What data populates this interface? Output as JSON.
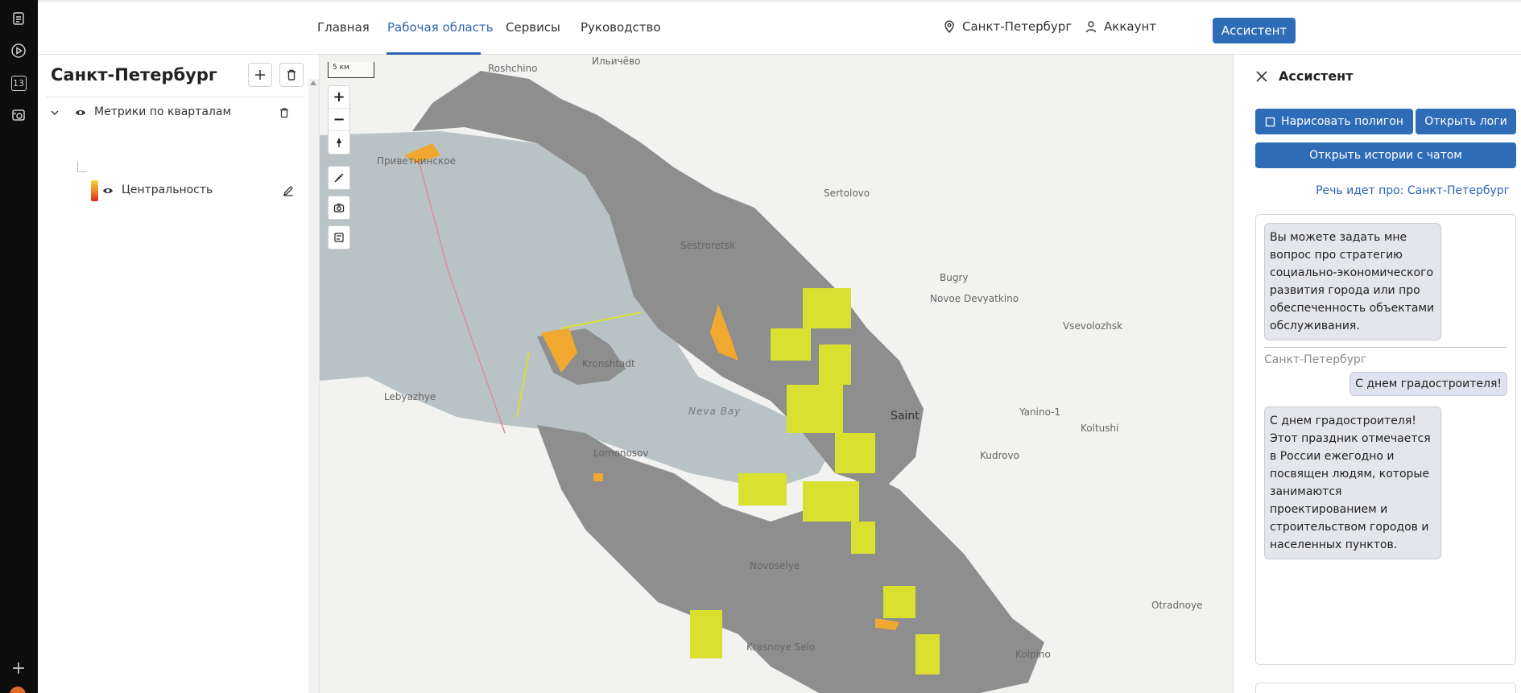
{
  "nav": {
    "tabs": [
      {
        "label": "Главная"
      },
      {
        "label": "Рабочая область"
      },
      {
        "label": "Сервисы"
      },
      {
        "label": "Руководство"
      }
    ],
    "active_tab": "Рабочая область",
    "location": "Санкт-Петербург",
    "account": "Аккаунт",
    "assistant_button": "Ассистент"
  },
  "rail": {
    "icons": [
      "document-icon",
      "play-icon",
      "calendar-13-icon",
      "camera-box-icon"
    ],
    "calendar_badge": "13"
  },
  "layers": {
    "title": "Санкт-Петербург",
    "groups": [
      {
        "name": "Метрики по кварталам",
        "children": [
          {
            "name": "Центральность"
          }
        ]
      }
    ]
  },
  "map": {
    "scale_label": "5 км",
    "labels": [
      "Roshchino",
      "Ильичёво",
      "Приветнинское",
      "Sertolovo",
      "Sestroretsk",
      "Novoe Devyatkino",
      "Vsevolozhsk",
      "Kronshtadt",
      "Lebyazhye",
      "Neva Bay",
      "Yanino-1",
      "Koltushi",
      "Novoselye",
      "Krasnoye Selo",
      "Otradnoye",
      "Kolpino",
      "Saint",
      "Bugry",
      "Kudrovo",
      "Lomonosov"
    ],
    "colors": {
      "water": "#b9c3c6",
      "land": "#8e8e8e",
      "metric_high": "#d9e02f",
      "metric_mid": "#f0a830",
      "boundary": "#e08a9a"
    }
  },
  "assistant": {
    "title": "Ассистент",
    "draw_polygon": "Нарисовать полигон",
    "open_logs": "Открыть логи",
    "open_history": "Открыть истории с чатом",
    "topic": "Речь идет про: Санкт-Петербург",
    "messages": [
      {
        "role": "assistant",
        "text": "Вы можете задать мне вопрос про стратегию социально-экономического развития города или про обеспеченность объектами обслуживания."
      },
      {
        "role": "user",
        "sender": "Санкт-Петербург",
        "text": "С днем градостроителя!"
      },
      {
        "role": "assistant",
        "text": "С днем градостроителя! Этот праздник отмечается в России ежегодно и посвящен людям, которые занимаются проектированием и строительством городов и населенных пунктов."
      }
    ]
  }
}
